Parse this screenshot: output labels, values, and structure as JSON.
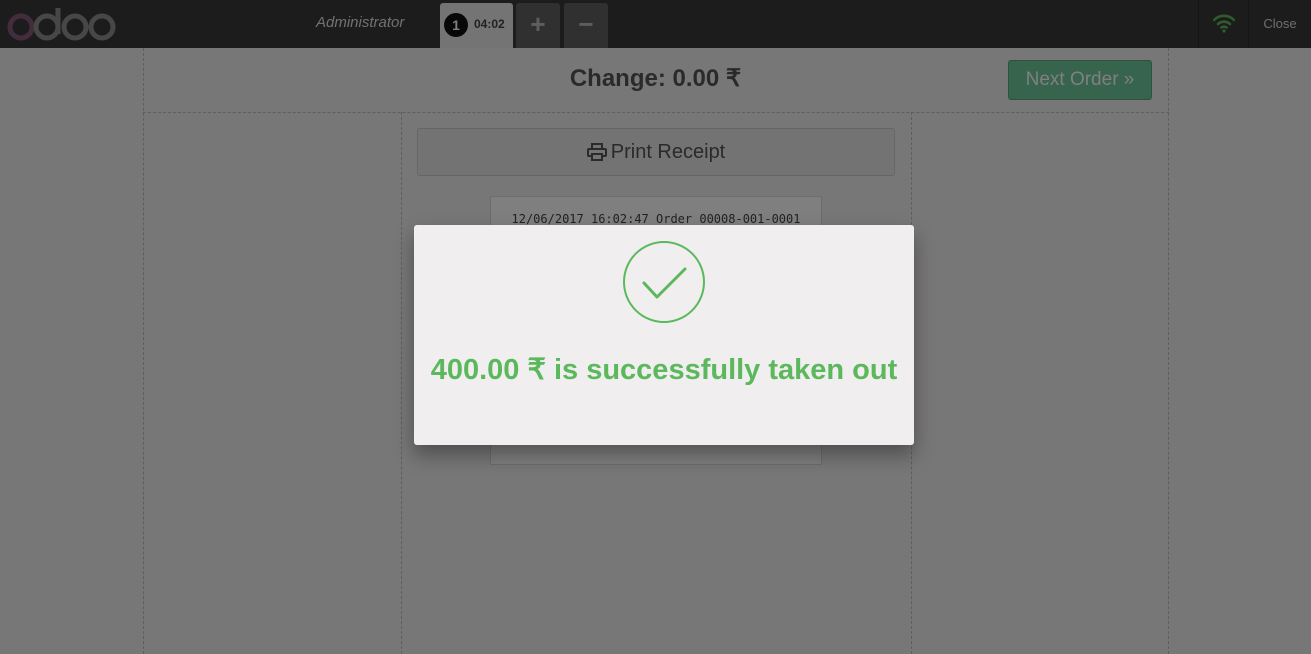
{
  "header": {
    "logo_text": "odoo",
    "cashier_name": "Administrator",
    "order_tab": {
      "sequence": "1",
      "time": "04:02"
    },
    "add_order_symbol": "+",
    "delete_order_symbol": "−",
    "close_label": "Close"
  },
  "receipt_screen": {
    "change_text": "Change: 0.00 ₹",
    "next_order_label": "Next Order »",
    "print_receipt_label": "Print Receipt",
    "receipt_first_line": "12/06/2017 16:02:47 Order 00008-001-0001"
  },
  "popup": {
    "message": "400.00 ₹ is successfully taken out"
  },
  "colors": {
    "success": "#5cb85c",
    "next_order": "#6ec89b",
    "topbar": "#393939",
    "logo_o": "#875a7b",
    "wifi": "#5cb85c"
  }
}
